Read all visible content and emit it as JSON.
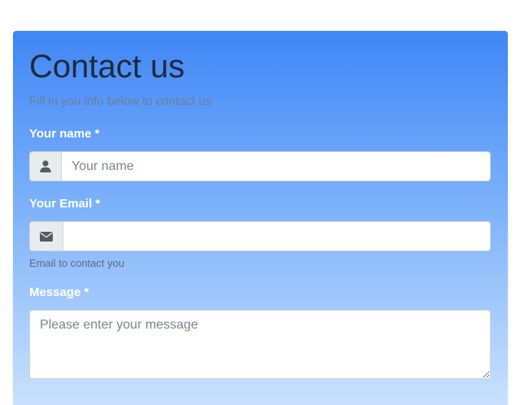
{
  "form": {
    "title": "Contact us",
    "subtitle": "Fill in you info below to contact us",
    "name": {
      "label": "Your name *",
      "placeholder": "Your name",
      "value": "",
      "icon": "user-icon"
    },
    "email": {
      "label": "Your Email *",
      "placeholder": "",
      "value": "",
      "icon": "envelope-icon",
      "help": "Email to contact you"
    },
    "message": {
      "label": "Message *",
      "placeholder": "Please enter your message",
      "value": ""
    }
  },
  "colors": {
    "gradient_top": "#3f86f6",
    "gradient_bottom": "#c9e1ff",
    "label": "#ffffff",
    "title": "#1f2a3a",
    "subtitle": "#6a7f98",
    "addon_bg": "#e9ecef"
  }
}
